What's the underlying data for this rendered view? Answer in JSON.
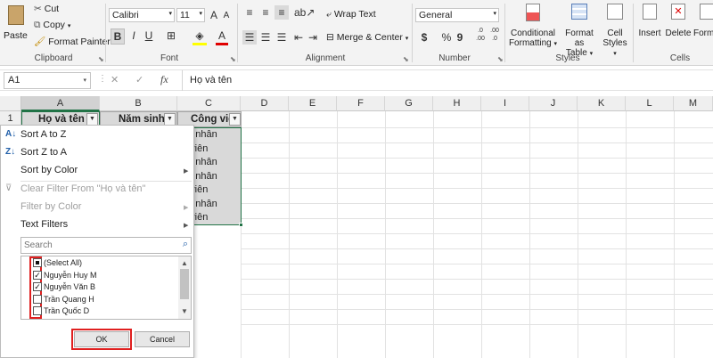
{
  "ribbon": {
    "clipboard": {
      "paste": "Paste",
      "cut": "Cut",
      "copy": "Copy",
      "format_painter": "Format Painter",
      "label": "Clipboard"
    },
    "font": {
      "name": "Calibri",
      "size": "11",
      "label": "Font",
      "bold": "B",
      "italic": "I",
      "underline": "U",
      "grow": "A",
      "shrink": "A"
    },
    "alignment": {
      "wrap_text": "Wrap Text",
      "merge_center": "Merge & Center",
      "label": "Alignment"
    },
    "number": {
      "format": "General",
      "currency": "$",
      "percent": "%",
      "comma": "9",
      "inc_dec": ".0\n.00",
      "dec_dec": ".00\n.0",
      "label": "Number"
    },
    "styles": {
      "conditional": "Conditional",
      "formatting": "Formatting",
      "format_as": "Format as",
      "table": "Table",
      "cell": "Cell",
      "styles_btn": "Styles",
      "label": "Styles"
    },
    "cells": {
      "insert": "Insert",
      "delete": "Delete",
      "format": "Forma",
      "label": "Cells"
    }
  },
  "formula_bar": {
    "name_box": "A1",
    "cancel": "✕",
    "enter": "✓",
    "fx": "fx",
    "content": "Họ và tên"
  },
  "grid": {
    "columns": [
      "A",
      "B",
      "C",
      "D",
      "E",
      "F",
      "G",
      "H",
      "I",
      "J",
      "K",
      "L",
      "M"
    ],
    "rows": [
      "1"
    ],
    "headers": {
      "a1": "Họ và tên",
      "b1": "Năm sinh",
      "c1": "Công việc"
    },
    "c_values": [
      "ng nhân",
      "h viên",
      "ng nhân",
      "ng nhân",
      "h viên",
      "ng nhân",
      "h viên"
    ]
  },
  "filter_menu": {
    "sort_az": "Sort A to Z",
    "sort_za": "Sort Z to A",
    "sort_color": "Sort by Color",
    "clear_filter": "Clear Filter From \"Họ và tên\"",
    "filter_color": "Filter by Color",
    "text_filters": "Text Filters",
    "search_placeholder": "Search",
    "items": [
      {
        "label": "(Select All)",
        "state": "partial"
      },
      {
        "label": "Nguyễn Huy M",
        "state": "checked"
      },
      {
        "label": "Nguyễn Văn B",
        "state": "checked"
      },
      {
        "label": "Trần Quang H",
        "state": "unchecked"
      },
      {
        "label": "Trần Quốc D",
        "state": "unchecked"
      }
    ],
    "ok": "OK",
    "cancel": "Cancel"
  },
  "colors": {
    "highlight": "#e02020",
    "selection_border": "#217346",
    "header_fill": "#d9d9d9"
  }
}
